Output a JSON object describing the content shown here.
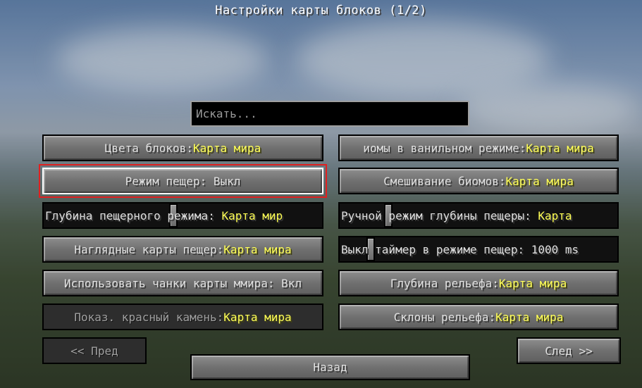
{
  "title": "Настройки карты блоков (1/2)",
  "search": {
    "placeholder": "Искать..."
  },
  "left": [
    {
      "label": "Цвета блоков: ",
      "value": "Карта мира"
    },
    {
      "label": "Режим пещер: Выкл",
      "value": ""
    },
    {
      "label": "Глубина пещерного режима: ",
      "value": "Карта мир"
    },
    {
      "label": "Наглядные карты пещер: ",
      "value": "Карта мира"
    },
    {
      "label": "Использовать чанки карты ммира: Вкл",
      "value": ""
    },
    {
      "label": "Показ. красный камень: ",
      "value": "Карта мира"
    }
  ],
  "right": [
    {
      "label": "иомы в ванильном режиме: ",
      "value": "Карта мира"
    },
    {
      "label": "Смешивание биомов: ",
      "value": "Карта мира"
    },
    {
      "label": "Ручной режим глубины пещеры: ",
      "value": "Карта"
    },
    {
      "label": "Выкл таймер в режиме пещер: 1000 ms",
      "value": ""
    },
    {
      "label": "Глубина рельефа: ",
      "value": "Карта мира"
    },
    {
      "label": "Склоны рельефа: ",
      "value": "Карта мира"
    }
  ],
  "nav": {
    "prev": "<< Пред",
    "next": "След >>",
    "back": "Назад"
  }
}
